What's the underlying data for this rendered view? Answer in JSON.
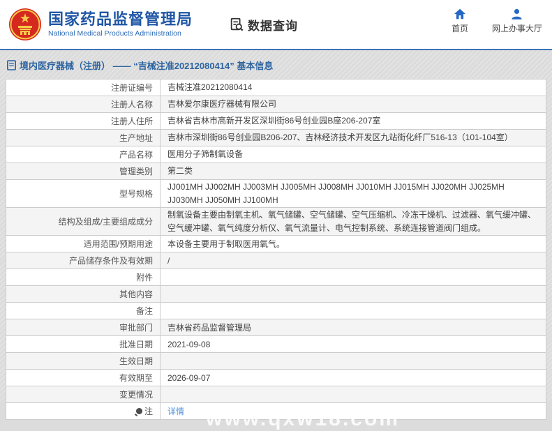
{
  "header": {
    "org_name_zh": "国家药品监督管理局",
    "org_name_en": "National Medical Products Administration",
    "section_title": "数据查询",
    "nav": [
      {
        "label": "首页"
      },
      {
        "label": "网上办事大厅"
      }
    ]
  },
  "breadcrumb": {
    "text": "境内医疗器械（注册） —— “吉械注准20212080414” 基本信息"
  },
  "table": {
    "rows": [
      {
        "label": "注册证编号",
        "value": "吉械注准20212080414"
      },
      {
        "label": "注册人名称",
        "value": "吉林爱尔康医疗器械有限公司"
      },
      {
        "label": "注册人住所",
        "value": "吉林省吉林市高新开发区深圳街86号创业园B座206-207室"
      },
      {
        "label": "生产地址",
        "value": "吉林市深圳街86号创业园B206-207、吉林经济技术开发区九站街化纤厂516-13（101-104室）"
      },
      {
        "label": "产品名称",
        "value": "医用分子筛制氧设备"
      },
      {
        "label": "管理类别",
        "value": "第二类"
      },
      {
        "label": "型号规格",
        "value": "JJ001MH JJ002MH JJ003MH JJ005MH JJ008MH JJ010MH JJ015MH JJ020MH JJ025MH JJ030MH JJ050MH JJ100MH"
      },
      {
        "label": "结构及组成/主要组成成分",
        "value": "制氧设备主要由制氧主机、氧气储罐、空气储罐、空气压缩机、冷冻干燥机、过滤器、氧气缓冲罐、空气缓冲罐、氧气纯度分析仪、氧气流量计、电气控制系统、系统连接管道阀门组成。"
      },
      {
        "label": "适用范围/预期用途",
        "value": "本设备主要用于制取医用氧气。"
      },
      {
        "label": "产品储存条件及有效期",
        "value": "/"
      },
      {
        "label": "附件",
        "value": ""
      },
      {
        "label": "其他内容",
        "value": ""
      },
      {
        "label": "备注",
        "value": ""
      },
      {
        "label": "审批部门",
        "value": "吉林省药品监督管理局"
      },
      {
        "label": "批准日期",
        "value": "2021-09-08"
      },
      {
        "label": "生效日期",
        "value": ""
      },
      {
        "label": "有效期至",
        "value": "2026-09-07"
      },
      {
        "label": "变更情况",
        "value": ""
      },
      {
        "label": "注",
        "value": "详情",
        "link": true,
        "label_icon": true
      }
    ]
  },
  "watermark": "www.qxw18.com",
  "colors": {
    "brand_blue": "#2056a5",
    "accent_blue": "#2e6cb5",
    "icon_blue": "#2368c4",
    "link_blue": "#4a90d9",
    "emblem_red": "#d5281e",
    "emblem_gold": "#f7c948",
    "row_alt_gray": "#f4f4f4",
    "border_gray": "#cccccc"
  }
}
